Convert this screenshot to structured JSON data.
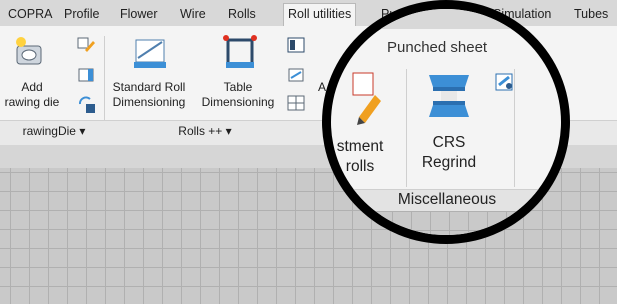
{
  "tabs": [
    "COPRA",
    "Profile",
    "Flower",
    "Wire",
    "Rolls",
    "Roll utilities",
    "Pu",
    "Simulation",
    "Tubes"
  ],
  "active_tab": "Roll utilities",
  "ribbon": {
    "add_drawing_die": {
      "line1": "Add",
      "line2": "rawing die"
    },
    "drawing_die_group": "rawingDie",
    "standard_roll": {
      "line1": "Standard Roll",
      "line2": "Dimensioning"
    },
    "table_dim": {
      "line1": "Table",
      "line2": "Dimensioning"
    },
    "rolls_group": "Rolls ++",
    "adjust_label": "A"
  },
  "magnifier": {
    "group_title": "Punched sheet",
    "adjustment": {
      "line1": "stment",
      "line2": "rolls"
    },
    "crs": {
      "line1": "CRS",
      "line2": "Regrind"
    },
    "misc_group": "Miscellaneous"
  },
  "colors": {
    "accent_blue": "#3c8fd6",
    "ribbon_bg": "#f4f4f4",
    "canvas_grid": "#c9c9c9"
  }
}
